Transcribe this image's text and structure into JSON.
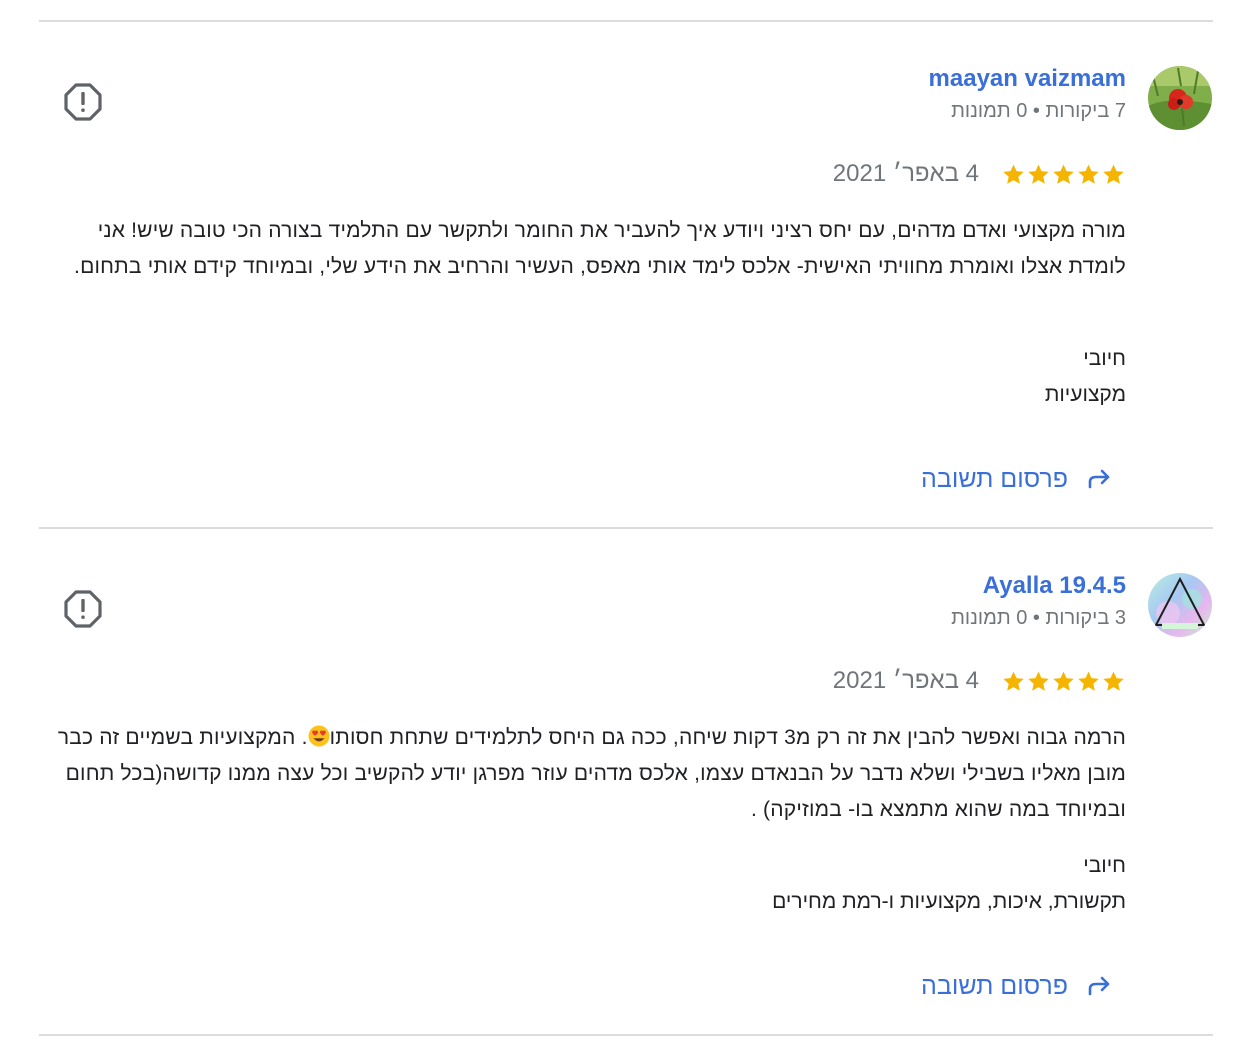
{
  "reviews": [
    {
      "author": "maayan vaizmam",
      "meta": "7 ביקורות • 0 תמונות",
      "stars": 5,
      "date": "4 באפר׳ 2021",
      "text": "מורה מקצועי ואדם מדהים, עם יחס רציני ויודע איך להעביר את החומר ולתקשר עם התלמיד בצורה הכי טובה שיש! אני לומדת אצלו ואומרת מחוויתי האישית- אלכס לימד אותי מאפס, העשיר והרחיב את הידע שלי, ובמיוחד קידם אותי בתחום.",
      "positive_title": "חיובי",
      "positive_value": "מקצועיות",
      "reply_label": "פרסום תשובה",
      "avatar_icon": "poppy-flower-photo",
      "flag_icon": "report-flag-icon"
    },
    {
      "author": "Ayalla 19.4.5",
      "meta": "3 ביקורות • 0 תמונות",
      "stars": 5,
      "date": "4 באפר׳ 2021",
      "text_before_emoji": "הרמה גבוה ואפשר להבין את זה רק מ3 דקות שיחה, ככה גם היחס לתלמידים שתחת חסותו",
      "text_after_emoji": ". המקצועיות בשמיים זה כבר מובן מאליו בשבילי ושלא נדבר על הבנאדם עצמו, אלכס מדהים עוזר מפרגן יודע להקשיב וכל עצה ממנו קדושה(בכל תחום ובמיוחד במה שהוא מתמצא בו- במוזיקה) .",
      "emoji": "heart-eyes-emoji",
      "positive_title": "חיובי",
      "positive_value": "תקשורת, איכות, מקצועיות ו-רמת מחירים",
      "reply_label": "פרסום תשובה",
      "avatar_icon": "triangle-pastel-avatar",
      "flag_icon": "report-flag-icon"
    }
  ],
  "colors": {
    "link_blue": "#3a6fd8",
    "star_gold": "#f4b400",
    "divider": "#dadce0",
    "meta_gray": "#70757a"
  }
}
